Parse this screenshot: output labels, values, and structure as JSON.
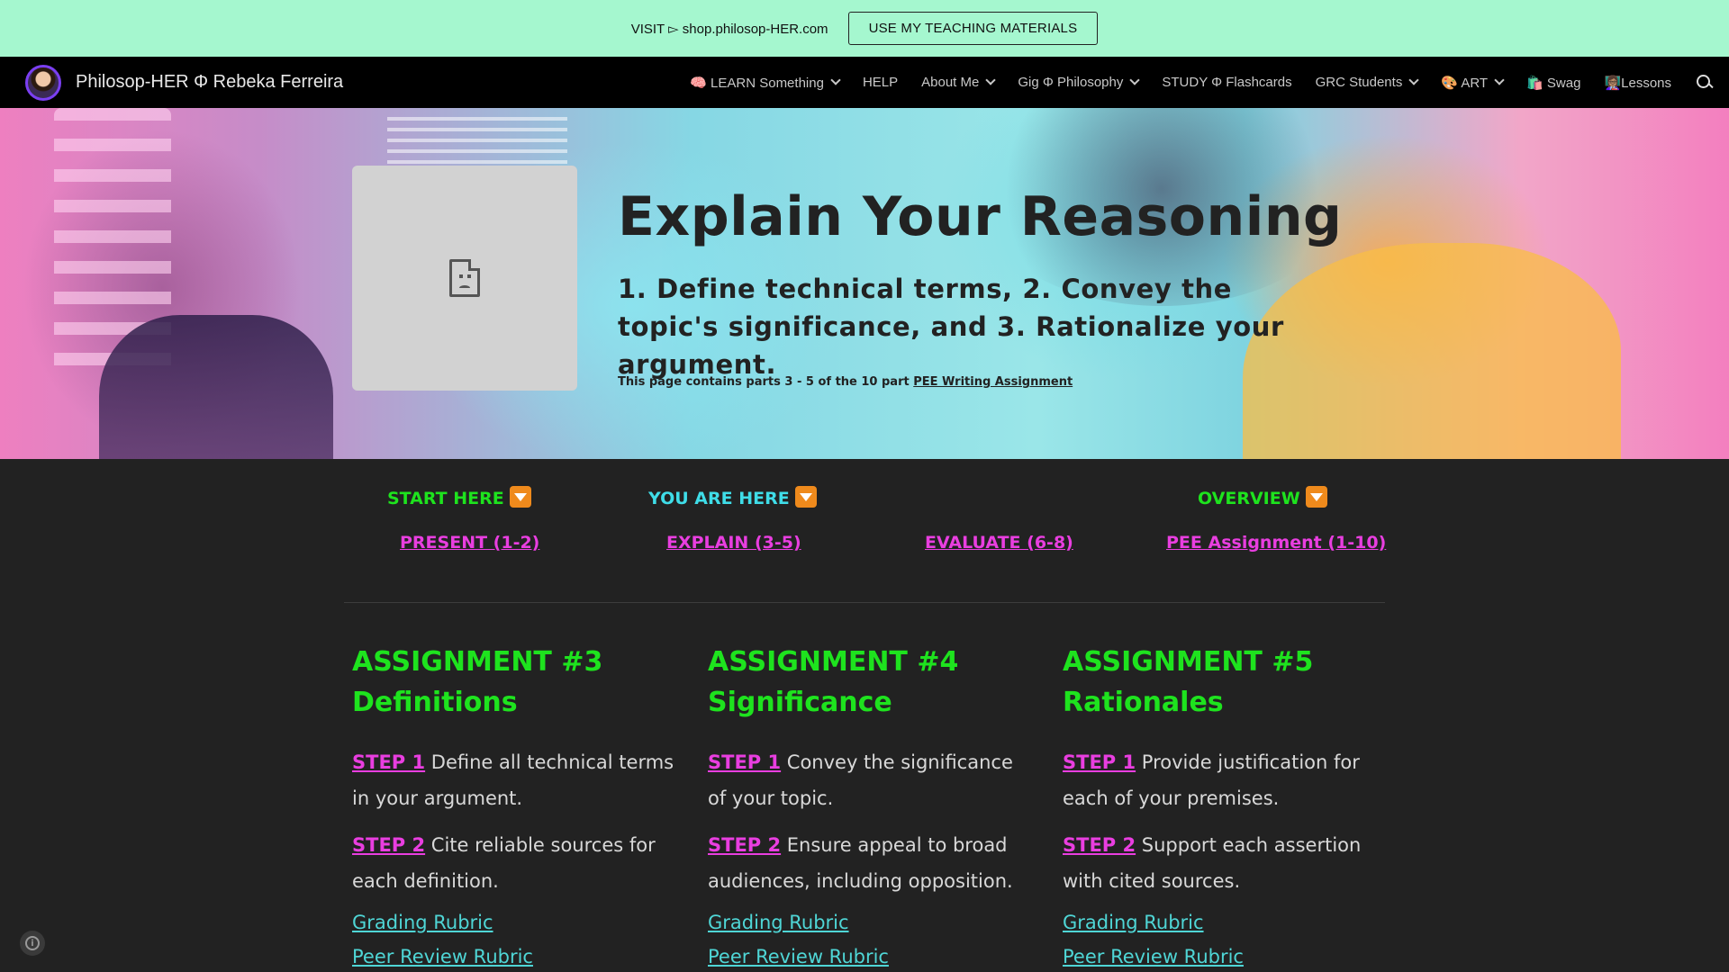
{
  "announcement": {
    "text": "VISIT ▻ shop.philosop-HER.com",
    "button_label": "USE MY TEACHING MATERIALS"
  },
  "nav": {
    "site_title": "Philosop-HER Φ Rebeka Ferreira",
    "items": [
      {
        "label": "🧠 LEARN Something",
        "has_dropdown": true
      },
      {
        "label": "HELP",
        "has_dropdown": false
      },
      {
        "label": "About Me",
        "has_dropdown": true
      },
      {
        "label": "Gig Φ Philosophy",
        "has_dropdown": true
      },
      {
        "label": "STUDY Φ Flashcards",
        "has_dropdown": false
      },
      {
        "label": "GRC Students",
        "has_dropdown": true
      },
      {
        "label": "🎨 ART",
        "has_dropdown": true
      },
      {
        "label": "🛍️ Swag",
        "has_dropdown": false
      },
      {
        "label": "👩🏽‍🏫Lessons",
        "has_dropdown": false
      }
    ],
    "search_icon": "search-icon"
  },
  "hero": {
    "title": "Explain Your Reasoning",
    "subtitle": "1. Define technical terms, 2. Convey the topic's significance, and 3. Rationalize your argument.",
    "note_prefix": "This page contains parts 3 - 5 of the 10 part ",
    "note_link": "PEE Writing Assignment"
  },
  "progress": {
    "labels": [
      {
        "text": "START HERE",
        "color": "#1ee31e"
      },
      {
        "text": "YOU ARE HERE",
        "color": "#3fdde8"
      },
      {
        "text": "OVERVIEW",
        "color": "#1ee31e"
      }
    ],
    "links": [
      "PRESENT (1-2)",
      "EXPLAIN (3-5)",
      "EVALUATE (6-8)",
      "PEE Assignment (1-10)"
    ]
  },
  "assignments": [
    {
      "title_line1": "ASSIGNMENT #3",
      "title_line2": "Definitions",
      "step1_link": "STEP 1",
      "step1_text": " Define all technical terms in your argument.",
      "step2_link": "STEP 2",
      "step2_text": " Cite reliable sources for each definition.",
      "rubric": "Grading Rubric",
      "peer_review": "Peer Review Rubric"
    },
    {
      "title_line1": "ASSIGNMENT #4",
      "title_line2": "Significance",
      "step1_link": "STEP 1",
      "step1_text": " Convey the significance of your topic.",
      "step2_link": "STEP 2",
      "step2_text": " Ensure appeal to broad audiences, including opposition.",
      "rubric": "Grading Rubric",
      "peer_review": "Peer Review Rubric"
    },
    {
      "title_line1": "ASSIGNMENT #5",
      "title_line2": "Rationales",
      "step1_link": "STEP 1",
      "step1_text": " Provide justification for each of your premises.",
      "step2_link": "STEP 2",
      "step2_text": " Support each assertion with cited sources.",
      "rubric": "Grading Rubric",
      "peer_review": "Peer Review Rubric"
    }
  ],
  "colors": {
    "accent_green": "#1ee31e",
    "accent_magenta": "#e93ee0",
    "accent_cyan": "#3fdde8",
    "link_teal": "#4fd6d6",
    "announce_bg": "#a5f7cf",
    "page_bg": "#222222"
  }
}
